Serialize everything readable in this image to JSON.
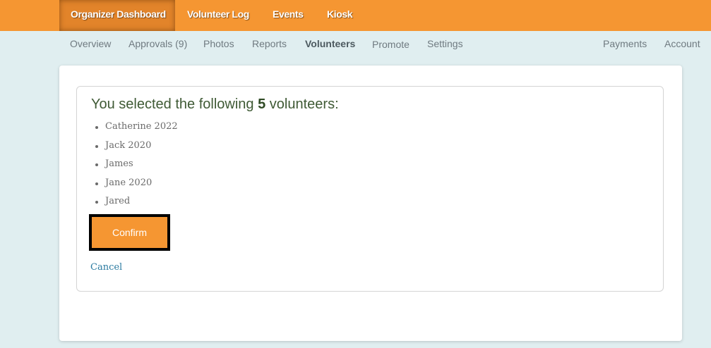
{
  "top_nav": {
    "items": [
      {
        "label": "Organizer Dashboard",
        "active": true
      },
      {
        "label": "Volunteer Log"
      },
      {
        "label": "Events"
      },
      {
        "label": "Kiosk"
      }
    ]
  },
  "sub_nav": {
    "left_items": [
      {
        "label": "Overview"
      },
      {
        "label": "Approvals (9)"
      },
      {
        "label": "Photos"
      },
      {
        "label": "Reports"
      },
      {
        "label": "Volunteers",
        "active": true
      },
      {
        "label": "Promote"
      },
      {
        "label": "Settings"
      }
    ],
    "right_items": [
      {
        "label": "Payments"
      },
      {
        "label": "Account"
      }
    ]
  },
  "selection": {
    "heading_prefix": "You selected the following",
    "count": "5",
    "heading_suffix": "volunteers:",
    "volunteers": [
      "Catherine 2022",
      "Jack 2020",
      "James",
      "Jane 2020",
      "Jared"
    ],
    "confirm_label": "Confirm",
    "cancel_label": "Cancel"
  },
  "colors": {
    "brand_orange": "#f59632",
    "background": "#e0eef0",
    "heading_green": "#3f5a35",
    "link_blue": "#2a7aa0"
  }
}
